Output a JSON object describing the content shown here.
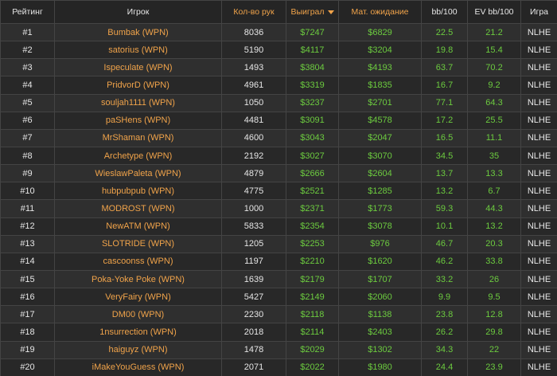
{
  "colors": {
    "accent": "#f0a34a",
    "positive": "#6ccb3f",
    "text": "#e6e6e6",
    "background": "#2b2b2b"
  },
  "table": {
    "headers": {
      "rank": "Рейтинг",
      "player": "Игрок",
      "hands": "Кол-во рук",
      "won": "Выиграл",
      "ev": "Мат. ожидание",
      "bb100": "bb/100",
      "ev_bb100": "EV bb/100",
      "game": "Игра"
    },
    "sorted_column": "won",
    "rows": [
      {
        "rank": "#1",
        "player": "Bumbak (WPN)",
        "hands": "8036",
        "won": "$7247",
        "ev": "$6829",
        "bb100": "22.5",
        "ev_bb100": "21.2",
        "game": "NLHE"
      },
      {
        "rank": "#2",
        "player": "satorius (WPN)",
        "hands": "5190",
        "won": "$4117",
        "ev": "$3204",
        "bb100": "19.8",
        "ev_bb100": "15.4",
        "game": "NLHE"
      },
      {
        "rank": "#3",
        "player": "Ispeculate (WPN)",
        "hands": "1493",
        "won": "$3804",
        "ev": "$4193",
        "bb100": "63.7",
        "ev_bb100": "70.2",
        "game": "NLHE"
      },
      {
        "rank": "#4",
        "player": "PridvorD (WPN)",
        "hands": "4961",
        "won": "$3319",
        "ev": "$1835",
        "bb100": "16.7",
        "ev_bb100": "9.2",
        "game": "NLHE"
      },
      {
        "rank": "#5",
        "player": "souljah1111 (WPN)",
        "hands": "1050",
        "won": "$3237",
        "ev": "$2701",
        "bb100": "77.1",
        "ev_bb100": "64.3",
        "game": "NLHE"
      },
      {
        "rank": "#6",
        "player": "paSHens (WPN)",
        "hands": "4481",
        "won": "$3091",
        "ev": "$4578",
        "bb100": "17.2",
        "ev_bb100": "25.5",
        "game": "NLHE"
      },
      {
        "rank": "#7",
        "player": "MrShaman (WPN)",
        "hands": "4600",
        "won": "$3043",
        "ev": "$2047",
        "bb100": "16.5",
        "ev_bb100": "11.1",
        "game": "NLHE"
      },
      {
        "rank": "#8",
        "player": "Archetype (WPN)",
        "hands": "2192",
        "won": "$3027",
        "ev": "$3070",
        "bb100": "34.5",
        "ev_bb100": "35",
        "game": "NLHE"
      },
      {
        "rank": "#9",
        "player": "WieslawPaleta (WPN)",
        "hands": "4879",
        "won": "$2666",
        "ev": "$2604",
        "bb100": "13.7",
        "ev_bb100": "13.3",
        "game": "NLHE"
      },
      {
        "rank": "#10",
        "player": "hubpubpub (WPN)",
        "hands": "4775",
        "won": "$2521",
        "ev": "$1285",
        "bb100": "13.2",
        "ev_bb100": "6.7",
        "game": "NLHE"
      },
      {
        "rank": "#11",
        "player": "MODROST (WPN)",
        "hands": "1000",
        "won": "$2371",
        "ev": "$1773",
        "bb100": "59.3",
        "ev_bb100": "44.3",
        "game": "NLHE"
      },
      {
        "rank": "#12",
        "player": "NewATM (WPN)",
        "hands": "5833",
        "won": "$2354",
        "ev": "$3078",
        "bb100": "10.1",
        "ev_bb100": "13.2",
        "game": "NLHE"
      },
      {
        "rank": "#13",
        "player": "SLOTRIDE (WPN)",
        "hands": "1205",
        "won": "$2253",
        "ev": "$976",
        "bb100": "46.7",
        "ev_bb100": "20.3",
        "game": "NLHE"
      },
      {
        "rank": "#14",
        "player": "cascoonss (WPN)",
        "hands": "1197",
        "won": "$2210",
        "ev": "$1620",
        "bb100": "46.2",
        "ev_bb100": "33.8",
        "game": "NLHE"
      },
      {
        "rank": "#15",
        "player": "Poka-Yoke Poke (WPN)",
        "hands": "1639",
        "won": "$2179",
        "ev": "$1707",
        "bb100": "33.2",
        "ev_bb100": "26",
        "game": "NLHE"
      },
      {
        "rank": "#16",
        "player": "VeryFairy (WPN)",
        "hands": "5427",
        "won": "$2149",
        "ev": "$2060",
        "bb100": "9.9",
        "ev_bb100": "9.5",
        "game": "NLHE"
      },
      {
        "rank": "#17",
        "player": "DM00 (WPN)",
        "hands": "2230",
        "won": "$2118",
        "ev": "$1138",
        "bb100": "23.8",
        "ev_bb100": "12.8",
        "game": "NLHE"
      },
      {
        "rank": "#18",
        "player": "1nsurrection (WPN)",
        "hands": "2018",
        "won": "$2114",
        "ev": "$2403",
        "bb100": "26.2",
        "ev_bb100": "29.8",
        "game": "NLHE"
      },
      {
        "rank": "#19",
        "player": "haiguyz (WPN)",
        "hands": "1478",
        "won": "$2029",
        "ev": "$1302",
        "bb100": "34.3",
        "ev_bb100": "22",
        "game": "NLHE"
      },
      {
        "rank": "#20",
        "player": "iMakeYouGuess (WPN)",
        "hands": "2071",
        "won": "$2022",
        "ev": "$1980",
        "bb100": "24.4",
        "ev_bb100": "23.9",
        "game": "NLHE"
      }
    ]
  }
}
